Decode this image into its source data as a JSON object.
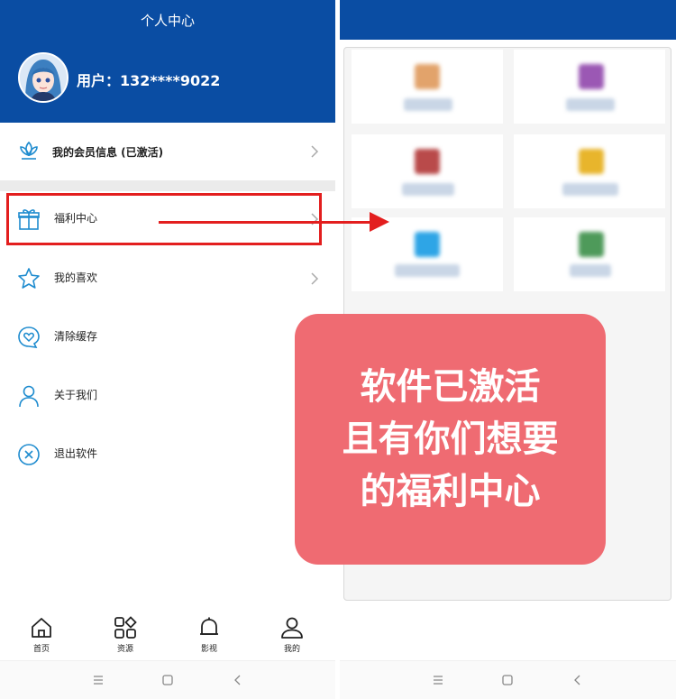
{
  "left_screen": {
    "header": {
      "title": "个人中心",
      "user_label": "用户：132****9022"
    },
    "member_row": {
      "label": "我的会员信息 (已激活)"
    },
    "menu_items": [
      {
        "label": "福利中心",
        "icon": "gift-icon",
        "has_chevron": true
      },
      {
        "label": "我的喜欢",
        "icon": "star-icon",
        "has_chevron": true
      },
      {
        "label": "清除缓存",
        "icon": "heart-bubble-icon",
        "has_chevron": false
      },
      {
        "label": "关于我们",
        "icon": "user-icon",
        "has_chevron": false
      },
      {
        "label": "退出软件",
        "icon": "close-circle-icon",
        "has_chevron": false
      }
    ],
    "tabbar": [
      {
        "label": "首页",
        "icon": "home-icon"
      },
      {
        "label": "资源",
        "icon": "grid-icon"
      },
      {
        "label": "影视",
        "icon": "bell-icon"
      },
      {
        "label": "我的",
        "icon": "person-icon"
      }
    ]
  },
  "annotation": {
    "callout_lines": [
      "软件已激活",
      "且有你们想要",
      "的福利中心"
    ]
  },
  "colors": {
    "brand_blue": "#0a4da3",
    "highlight_red": "#e31e1e",
    "callout_bg": "#ef6b72",
    "icon_blue": "#1f8ccf"
  }
}
